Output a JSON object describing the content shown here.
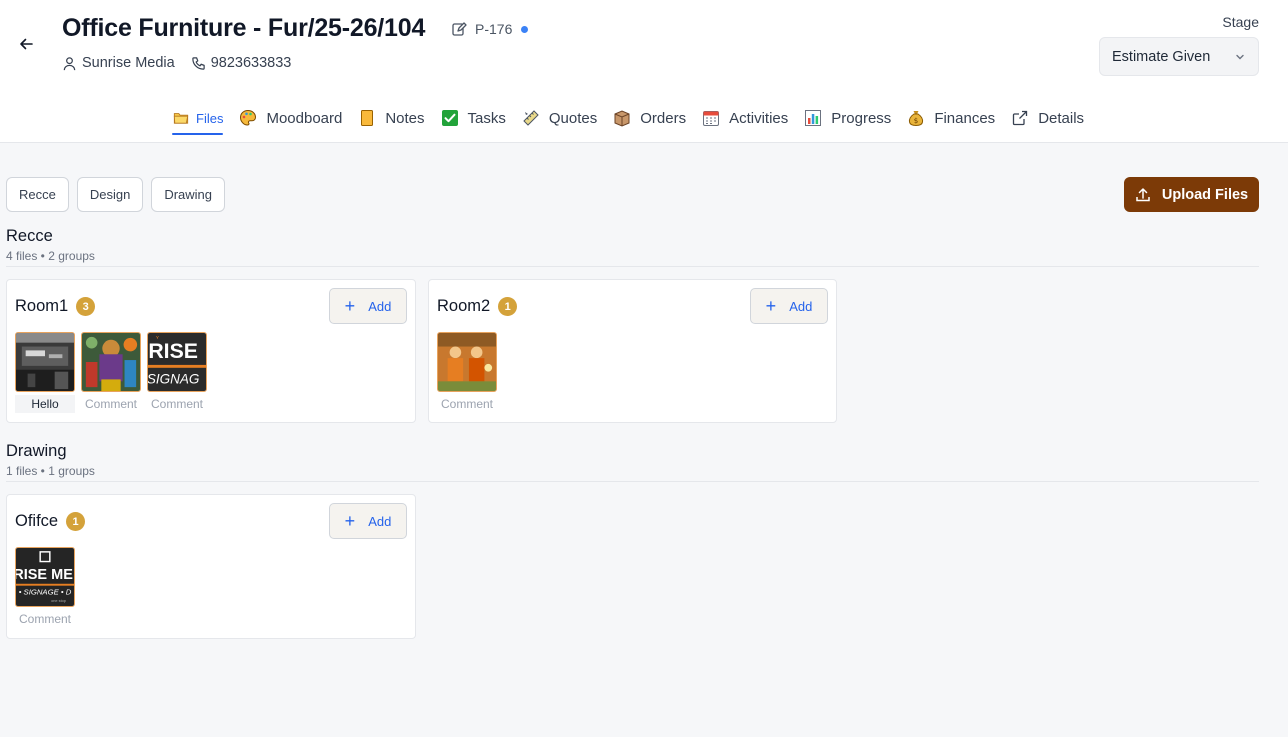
{
  "header": {
    "title": "Office Furniture - Fur/25-26/104",
    "project_code": "P-176",
    "client": "Sunrise Media",
    "phone": "9823633833",
    "stage_label": "Stage",
    "stage_value": "Estimate Given"
  },
  "tabs": [
    {
      "label": "Files",
      "icon": "folder-icon",
      "active": true
    },
    {
      "label": "Moodboard",
      "icon": "palette-icon"
    },
    {
      "label": "Notes",
      "icon": "note-icon"
    },
    {
      "label": "Tasks",
      "icon": "checkbox-icon"
    },
    {
      "label": "Quotes",
      "icon": "ruler-icon"
    },
    {
      "label": "Orders",
      "icon": "box-icon"
    },
    {
      "label": "Activities",
      "icon": "calendar-icon"
    },
    {
      "label": "Progress",
      "icon": "bar-chart-icon"
    },
    {
      "label": "Finances",
      "icon": "money-bag-icon"
    },
    {
      "label": "Details",
      "icon": "external-link-icon"
    }
  ],
  "filters": [
    "Recce",
    "Design",
    "Drawing"
  ],
  "upload_label": "Upload Files",
  "add_label": "Add",
  "sections": [
    {
      "title": "Recce",
      "summary": "4 files • 2 groups",
      "groups": [
        {
          "name": "Room1",
          "count": "3",
          "files": [
            {
              "caption": "Hello",
              "kind": "dark-photo"
            },
            {
              "caption": "Comment",
              "kind": "colorful-photo"
            },
            {
              "caption": "Comment",
              "kind": "rise-signage-logo"
            }
          ]
        },
        {
          "name": "Room2",
          "count": "1",
          "files": [
            {
              "caption": "Comment",
              "kind": "deity-painting"
            }
          ]
        }
      ]
    },
    {
      "title": "Drawing",
      "summary": "1 files • 1 groups",
      "groups": [
        {
          "name": "Ofifce",
          "count": "1",
          "files": [
            {
              "caption": "Comment",
              "kind": "rise-media-logo"
            }
          ]
        }
      ]
    }
  ],
  "colors": {
    "accent": "#2563eb",
    "upload_button": "#7c3a07",
    "badge": "#d4a23a",
    "status_dot": "#3b82f6"
  }
}
